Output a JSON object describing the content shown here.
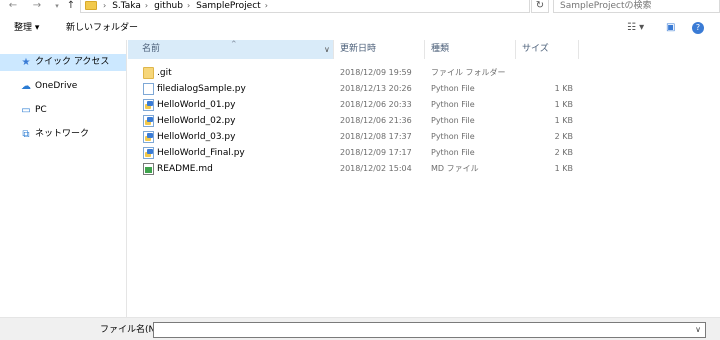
{
  "address": {
    "crumbs": [
      "S.Taka",
      "github",
      "SampleProject"
    ],
    "search_placeholder": "SampleProjectの検索"
  },
  "icons": {
    "back": "arrow-left-icon",
    "forward": "arrow-right-icon",
    "up": "arrow-up-icon",
    "refresh": "refresh-icon",
    "view": "view-options-icon",
    "preview": "preview-pane-icon",
    "help": "help-icon"
  },
  "toolbar": {
    "organize_label": "整理 ▾",
    "new_folder_label": "新しいフォルダー"
  },
  "sidebar": {
    "items": [
      {
        "label": "クイック アクセス",
        "icon": "star-icon"
      },
      {
        "label": "OneDrive",
        "icon": "cloud-icon"
      },
      {
        "label": "PC",
        "icon": "computer-icon"
      },
      {
        "label": "ネットワーク",
        "icon": "network-icon"
      }
    ]
  },
  "columns": {
    "name": "名前",
    "date": "更新日時",
    "type": "種類",
    "size": "サイズ"
  },
  "files": [
    {
      "name": ".git",
      "date": "2018/12/09 19:59",
      "type": "ファイル フォルダー",
      "size": "",
      "icon": "folder-icon"
    },
    {
      "name": "filedialogSample.py",
      "date": "2018/12/13 20:26",
      "type": "Python File",
      "size": "1 KB",
      "icon": "python-file-icon"
    },
    {
      "name": "HelloWorld_01.py",
      "date": "2018/12/06 20:33",
      "type": "Python File",
      "size": "1 KB",
      "icon": "python-file-icon"
    },
    {
      "name": "HelloWorld_02.py",
      "date": "2018/12/06 21:36",
      "type": "Python File",
      "size": "1 KB",
      "icon": "python-file-icon"
    },
    {
      "name": "HelloWorld_03.py",
      "date": "2018/12/08 17:37",
      "type": "Python File",
      "size": "2 KB",
      "icon": "python-file-icon"
    },
    {
      "name": "HelloWorld_Final.py",
      "date": "2018/12/09 17:17",
      "type": "Python File",
      "size": "2 KB",
      "icon": "python-file-icon"
    },
    {
      "name": "README.md",
      "date": "2018/12/02 15:04",
      "type": "MD ファイル",
      "size": "1 KB",
      "icon": "markdown-file-icon"
    }
  ],
  "filename_bar": {
    "label": "ファイル名(N):",
    "value": ""
  }
}
